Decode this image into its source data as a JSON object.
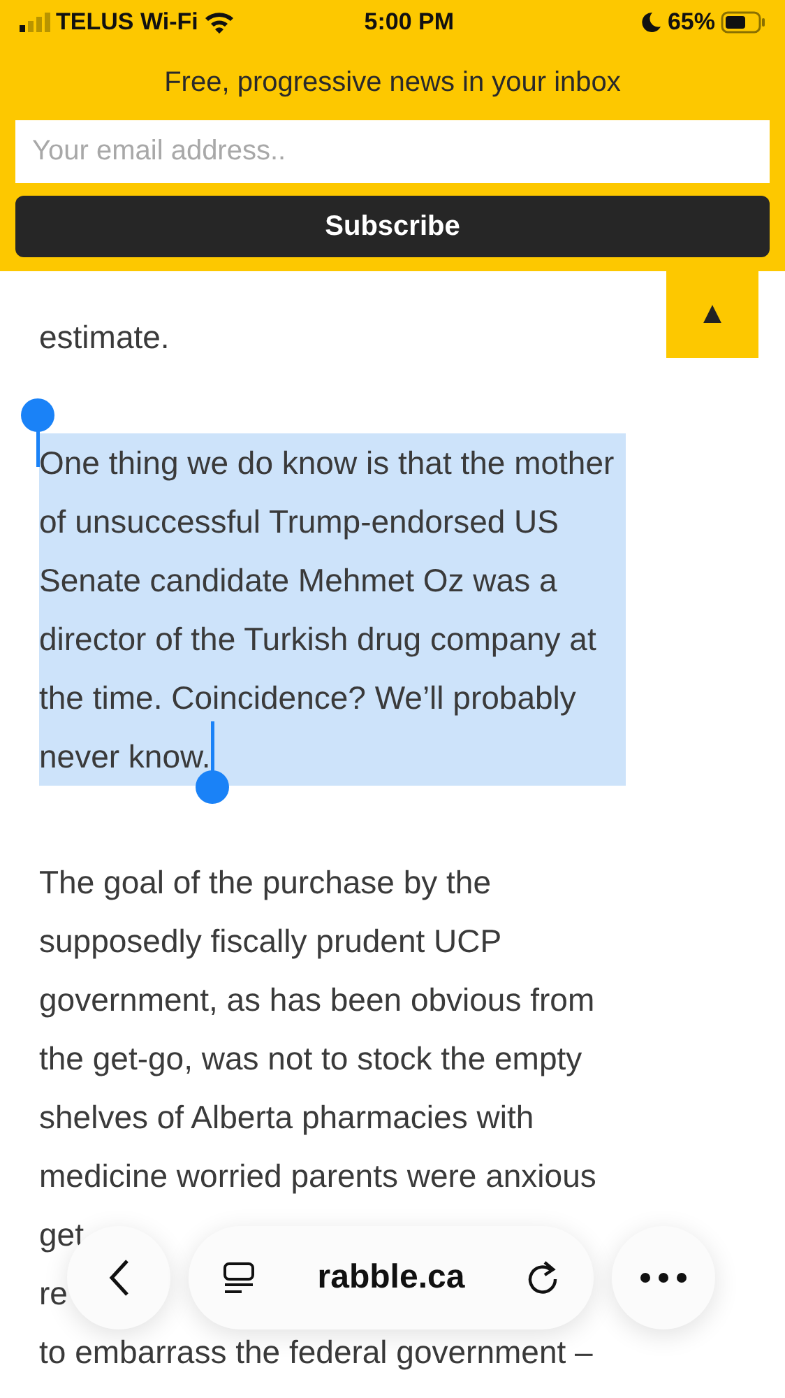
{
  "status_bar": {
    "carrier": "TELUS Wi-Fi",
    "time": "5:00 PM",
    "battery": "65%"
  },
  "banner": {
    "text": "Free, progressive news in your inbox",
    "placeholder": "Your email address..",
    "button": "Subscribe"
  },
  "back_to_top": "▲",
  "paragraphs": [
    {
      "selected": false,
      "lines": [
        "estimate."
      ]
    },
    {
      "selected": true,
      "lines": [
        "One thing we do know is that the mother",
        "of unsuccessful Trump-endorsed US",
        "Senate candidate Mehmet Oz was a",
        "director of the Turkish drug company at",
        "the time. Coincidence? We’ll probably",
        "never know."
      ]
    },
    {
      "selected": false,
      "lines": [
        "The goal of the purchase by the",
        "supposedly fiscally prudent UCP",
        "government, as has been obvious from",
        "the get-go, was not to stock the empty",
        "shelves of Alberta pharmacies with",
        "medicine worried parents were anxious",
        "get",
        "re",
        "to embarrass the federal government –"
      ]
    }
  ],
  "toolbar": {
    "url": "rabble.ca"
  }
}
